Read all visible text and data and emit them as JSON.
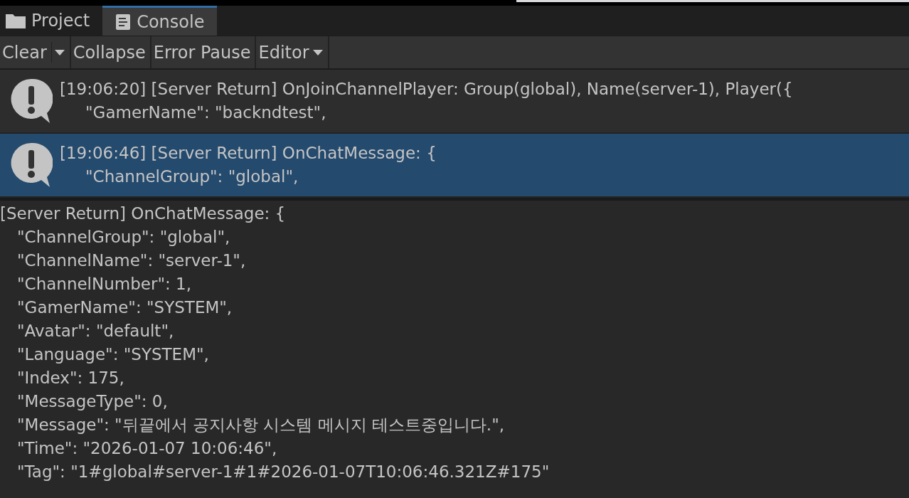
{
  "tabs": [
    {
      "label": "Project",
      "kind": "folder",
      "selected": false
    },
    {
      "label": "Console",
      "kind": "console",
      "selected": true
    }
  ],
  "toolbar": [
    {
      "label": "Clear",
      "kind": "split"
    },
    {
      "label": "Collapse",
      "kind": "button"
    },
    {
      "label": "Error Pause",
      "kind": "button"
    },
    {
      "label": "Editor",
      "kind": "dropdown"
    }
  ],
  "log_entries": [
    {
      "lines": [
        "[19:06:20] [Server Return] OnJoinChannelPlayer: Group(global), Name(server-1), Player({",
        "\"GamerName\": \"backndtest\","
      ],
      "selected": false
    },
    {
      "lines": [
        "[19:06:46] [Server Return] OnChatMessage: {",
        "\"ChannelGroup\": \"global\","
      ],
      "selected": true
    }
  ],
  "detail": {
    "first_line": "[Server Return] OnChatMessage: {",
    "lines": [
      "\"ChannelGroup\": \"global\",",
      "\"ChannelName\": \"server-1\",",
      "\"ChannelNumber\": 1,",
      "\"GamerName\": \"SYSTEM\",",
      "\"Avatar\": \"default\",",
      "\"Language\": \"SYSTEM\",",
      "\"Index\": 175,",
      "\"MessageType\": 0,",
      "\"Message\": \"뒤끝에서 공지사항 시스템 메시지 테스트중입니다.\",",
      "\"Time\": \"2026-01-07 10:06:46\",",
      "\"Tag\": \"1#global#server-1#1#2026-01-07T10:06:46.321Z#175\""
    ]
  }
}
